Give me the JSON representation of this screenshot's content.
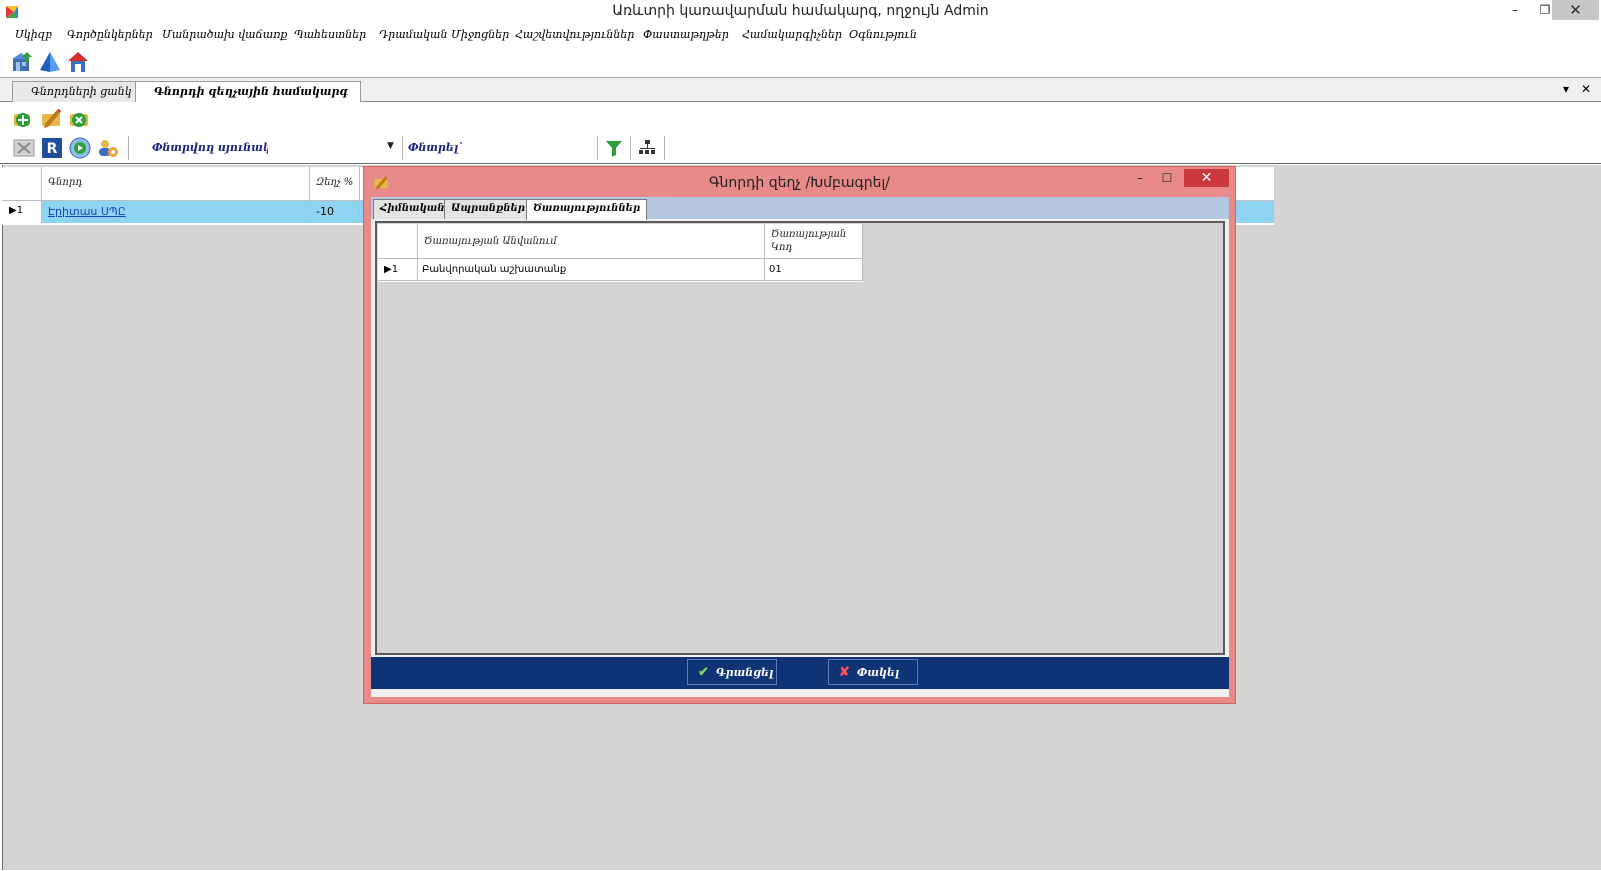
{
  "window": {
    "title": "Առևտրի կառավարման համակարգ, ողջույն Admin",
    "minimize": "–",
    "restore": "❐",
    "close": "✕"
  },
  "menu": [
    "Սկիզբ",
    "Գործընկերներ",
    "Մանրածախ վաճառք",
    "Պահեստներ",
    "Դրամական Միջոցներ",
    "Հաշվետվություններ",
    "Փաստաթղթեր",
    "Համակարգիչներ",
    "Օգնություն"
  ],
  "doc_tabs": [
    {
      "label": "Գնորդների ցանկ"
    },
    {
      "label": "Գնորդի զեղչային համակարգ"
    }
  ],
  "tab_strip": {
    "dropdown": "▾",
    "close": "✕"
  },
  "filter": {
    "column_label": "Փնտրվող սյունակ`",
    "search_label": "Փնտրել`"
  },
  "grid": {
    "columns": [
      "Գնորդ",
      "Զեղչ %"
    ],
    "rows": [
      {
        "indicator": "▶1",
        "customer": "Էրիտաս ՍՊԸ",
        "discount": "-10"
      }
    ]
  },
  "dialog": {
    "title": "Գնորդի զեղչ /Խմբագրել/",
    "minimize": "–",
    "maximize": "☐",
    "close": "✕",
    "tabs": [
      "Հիմնական",
      "Ապրանքներ",
      "Ծառայություններ"
    ],
    "services_grid": {
      "columns": [
        "Ծառայության Անվանում",
        "Ծառայության Կոդ"
      ],
      "rows": [
        {
          "indicator": "▶1",
          "name": "Բանվորական աշխատանք",
          "code": "01"
        }
      ]
    },
    "buttons": {
      "save": "Գրանցել",
      "close": "Փակել"
    }
  }
}
